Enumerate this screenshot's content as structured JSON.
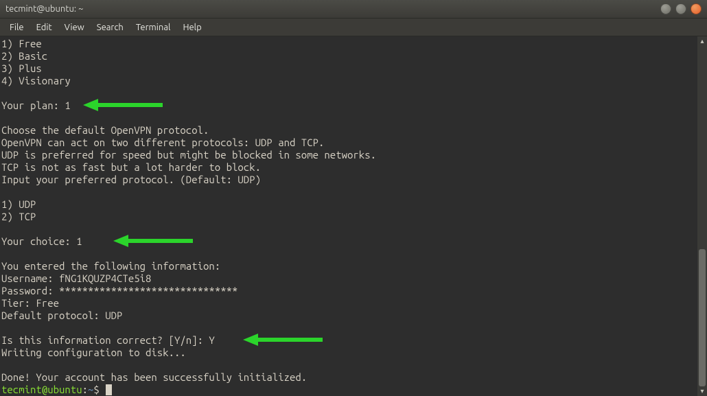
{
  "window": {
    "title": "tecmint@ubuntu: ~"
  },
  "menubar": {
    "items": [
      "File",
      "Edit",
      "View",
      "Search",
      "Terminal",
      "Help"
    ]
  },
  "terminal": {
    "plan_options": [
      "1) Free",
      "2) Basic",
      "3) Plus",
      "4) Visionary"
    ],
    "plan_prompt": "Your plan: ",
    "plan_answer": "1",
    "protocol_intro": [
      "Choose the default OpenVPN protocol.",
      "OpenVPN can act on two different protocols: UDP and TCP.",
      "UDP is preferred for speed but might be blocked in some networks.",
      "TCP is not as fast but a lot harder to block.",
      "Input your preferred protocol. (Default: UDP)"
    ],
    "protocol_options": [
      "1) UDP",
      "2) TCP"
    ],
    "choice_prompt": "Your choice: ",
    "choice_answer": "1",
    "summary_header": "You entered the following information:",
    "summary_username_label": "Username: ",
    "summary_username": "fNG1KQUZP4CTe5i8",
    "summary_password_label": "Password: ",
    "summary_password": "*******************************",
    "summary_tier_label": "Tier: ",
    "summary_tier": "Free",
    "summary_protocol_label": "Default protocol: ",
    "summary_protocol": "UDP",
    "confirm_prompt": "Is this information correct? [Y/n]: ",
    "confirm_answer": "Y",
    "writing": "Writing configuration to disk...",
    "done": "Done! Your account has been successfully initialized.",
    "shell_prompt_user": "tecmint@ubuntu",
    "shell_prompt_sep": ":",
    "shell_prompt_path": "~",
    "shell_prompt_end": "$ "
  },
  "annotations": {
    "arrow_color": "#2bd42b"
  }
}
